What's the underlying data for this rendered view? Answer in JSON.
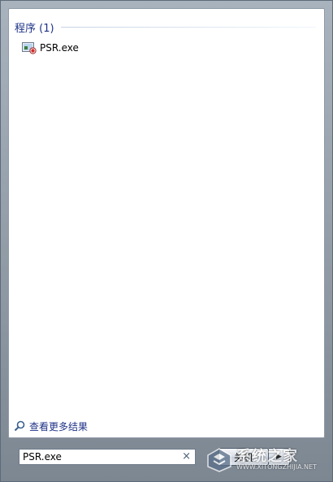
{
  "results_pane": {
    "group_title": "程序 (1)",
    "items": [
      {
        "label": "PSR.exe",
        "icon": "steps-recorder-app-icon"
      }
    ],
    "see_more_label": "查看更多结果",
    "see_more_icon": "magnifier-icon"
  },
  "search": {
    "value": "PSR.exe",
    "clear_glyph": "×"
  },
  "shutdown": {
    "label": "关机",
    "arrow_glyph": "▶"
  },
  "watermark": {
    "name": "系统之家",
    "url": "WWW.XITONGZHIJIA.NET"
  },
  "colors": {
    "group_title": "#1e3287",
    "frame": "#8a8f96"
  }
}
